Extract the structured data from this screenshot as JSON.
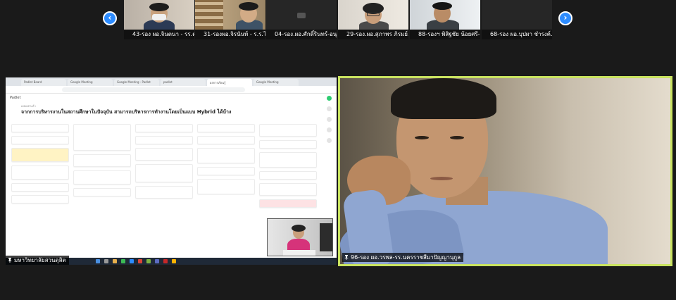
{
  "participants": [
    {
      "name": "43-รอง ผอ.จินตนา - รร.ค...",
      "muted": true
    },
    {
      "name": "31-รองผอ.จิรนันท์ - ร.ร.ไ...",
      "muted": true
    },
    {
      "name": "04-รอง.ผอ.ศักดิ์รินทร์-อนุ...",
      "muted": true
    },
    {
      "name": "29-รอง.ผอ.สุภาพร ภิรมย์...",
      "muted": true
    },
    {
      "name": "88-รองฯ พิสิฐชัย น้อยศรี-...",
      "muted": true
    },
    {
      "name": "68-รอง ผอ.บุปผา ชำรงค์...",
      "muted": true
    }
  ],
  "shared_screen": {
    "owner_label": "มหาวิทยาลัยสวนดุสิต",
    "browser_tabs": [
      "Padlet Board",
      "Google Meeting",
      "Google Meeting - Padlet",
      "padlet",
      "ผลการเรียนรู้",
      "Google Meeting"
    ],
    "board_title": "จากการบริหารงานในสถานศึกษาในปัจจุบัน สามารถบริหารการทำงานโดยเป็นแบบ Hybrid ได้บ้าง",
    "board_sub": "เผยแพร่แล้ว",
    "app_name": "Padlet"
  },
  "active_speaker": {
    "label": "96-รอง ผอ.วรพล-รร.นครราชสีมาปัญญานุกูล",
    "highlight_color": "#c9e360"
  },
  "colors": {
    "accent": "#2d8cff",
    "muted_red": "#e02828"
  }
}
